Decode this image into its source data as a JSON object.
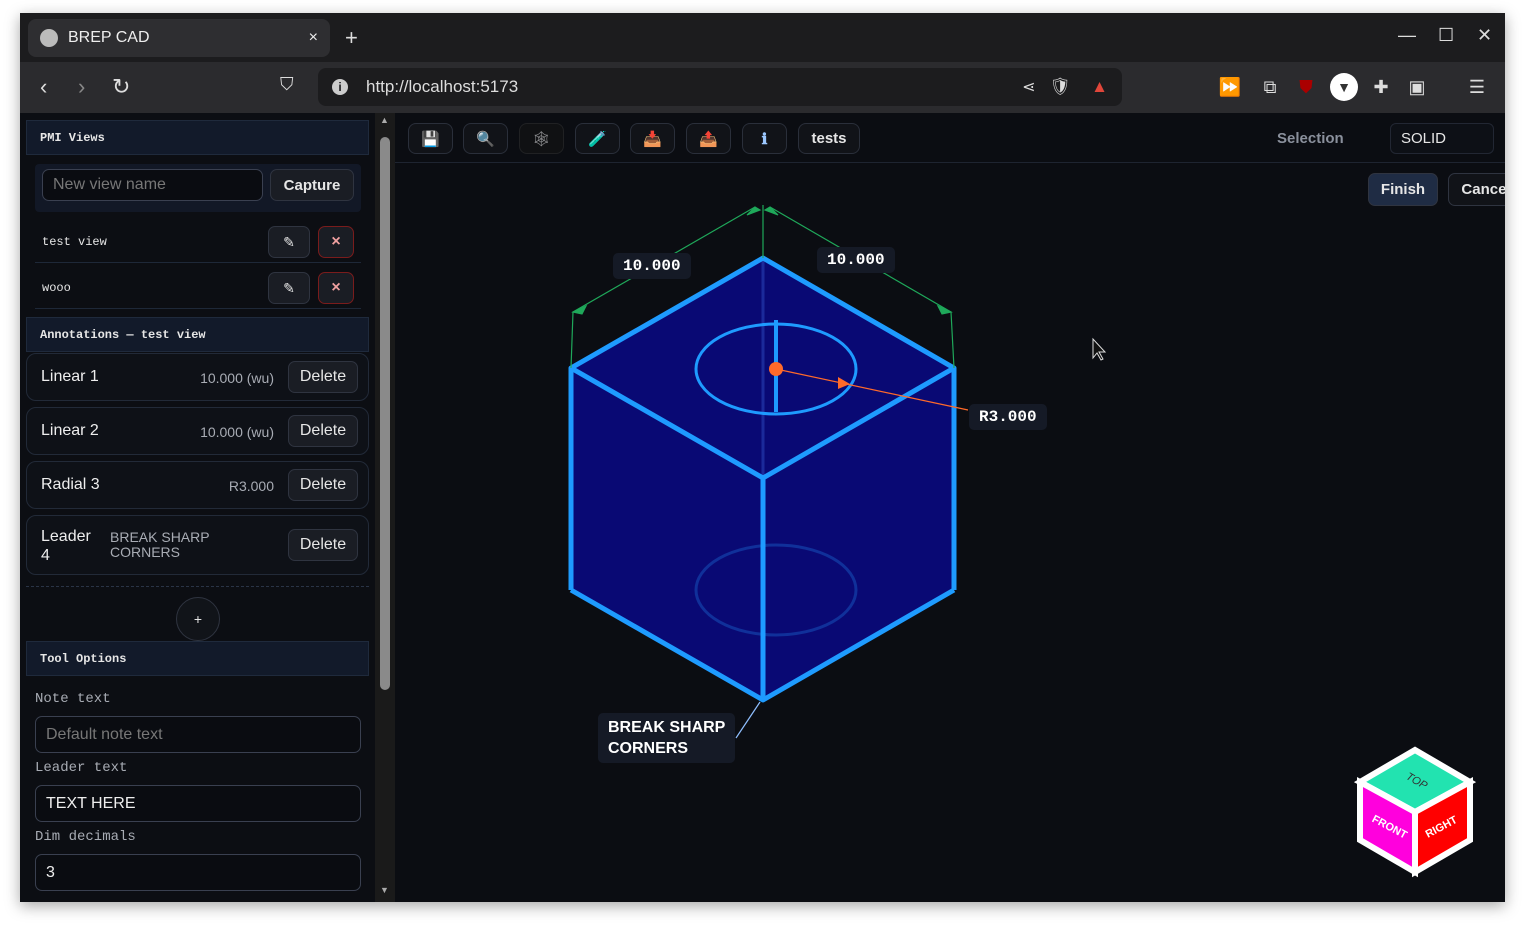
{
  "browser": {
    "tab_title": "BREP CAD",
    "url": "http://localhost:5173",
    "new_tab": "+",
    "close_tab": "×"
  },
  "sidebar": {
    "pmi_views": {
      "title": "PMI Views",
      "name_placeholder": "New view name",
      "capture_label": "Capture",
      "views": [
        {
          "name": "test view"
        },
        {
          "name": "wooo"
        }
      ],
      "edit_icon": "✎",
      "delete_icon": "×"
    },
    "annotations": {
      "title": "Annotations — test view",
      "delete_label": "Delete",
      "items": [
        {
          "name": "Linear 1",
          "value": "10.000 (wu)"
        },
        {
          "name": "Linear 2",
          "value": "10.000 (wu)"
        },
        {
          "name": "Radial 3",
          "value": "R3.000"
        },
        {
          "name": "Leader 4",
          "value": "BREAK SHARP CORNERS"
        }
      ],
      "add_label": "+"
    },
    "tool_options": {
      "title": "Tool Options",
      "note_label": "Note text",
      "note_placeholder": "Default note text",
      "leader_label": "Leader text",
      "leader_value": "TEXT HERE",
      "decimals_label": "Dim decimals",
      "decimals_value": "3"
    }
  },
  "toolbar": {
    "buttons": [
      {
        "name": "save",
        "icon": "💾"
      },
      {
        "name": "zoom",
        "icon": "🔍"
      },
      {
        "name": "wireframe",
        "icon": "🕸"
      },
      {
        "name": "test",
        "icon": "🧪"
      },
      {
        "name": "import",
        "icon": "📥"
      },
      {
        "name": "export",
        "icon": "📤"
      },
      {
        "name": "info",
        "icon": "ℹ"
      }
    ],
    "tests_label": "tests",
    "selection_label": "Selection",
    "selection_value": "SOLID",
    "finish_label": "Finish",
    "cancel_label": "Cancel"
  },
  "viewport": {
    "dim1": "10.000",
    "dim2": "10.000",
    "radial": "R3.000",
    "leader_line1": "BREAK SHARP",
    "leader_line2": "CORNERS",
    "viewcube": {
      "top": "TOP",
      "front": "FRONT",
      "right": "RIGHT"
    },
    "colors": {
      "solid": "#0a0a7a",
      "edge": "#1e9bff",
      "dimension": "#1fa85a",
      "radial": "#ff6a2a"
    }
  }
}
